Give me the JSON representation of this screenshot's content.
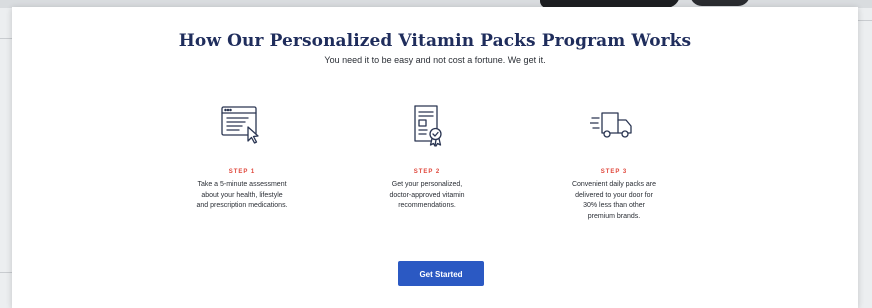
{
  "program": {
    "title": "How Our Personalized Vitamin Packs Program Works",
    "subtitle": "You need it to be easy and not cost a fortune. We get it."
  },
  "steps": [
    {
      "icon": "browser-window-cursor-icon",
      "label": "STEP 1",
      "description": "Take a 5-minute assessment\nabout your health, lifestyle\nand prescription medications."
    },
    {
      "icon": "certificate-document-icon",
      "label": "STEP 2",
      "description": "Get your personalized,\ndoctor-approved vitamin\nrecommendations."
    },
    {
      "icon": "delivery-truck-icon",
      "label": "STEP 3",
      "description": "Convenient daily packs are\ndelivered to your door for\n30% less than other\npremium brands."
    }
  ],
  "cta": {
    "label": "Get Started"
  },
  "colors": {
    "title": "#1f2d5c",
    "step_label": "#e0463a",
    "button": "#2b59c3",
    "icon_stroke": "#2a3552"
  }
}
